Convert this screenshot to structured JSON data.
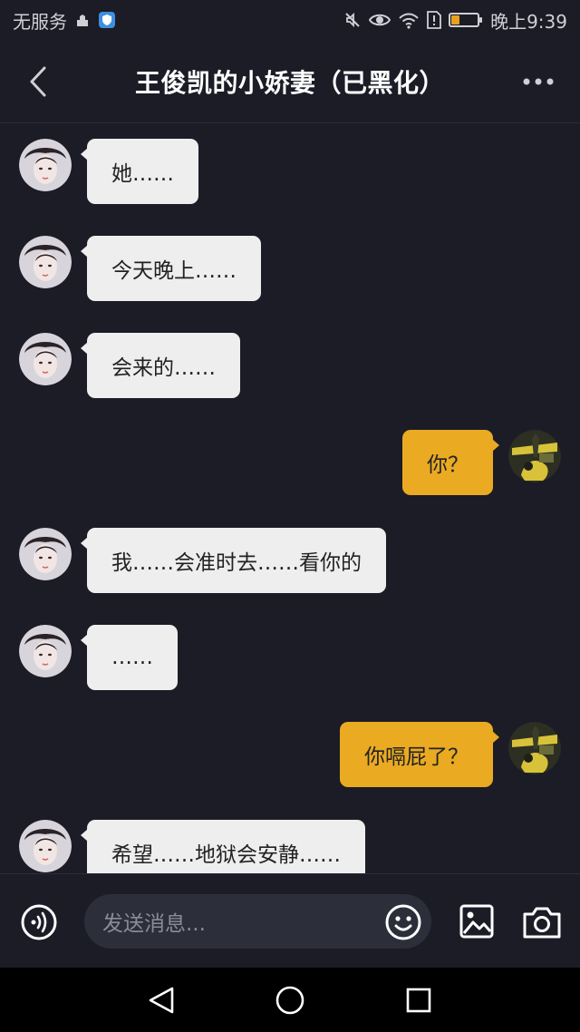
{
  "status_bar": {
    "carrier": "无服务",
    "time": "晚上9:39"
  },
  "header": {
    "title": "王俊凯的小娇妻（已黑化）"
  },
  "messages": [
    {
      "side": "left",
      "text": "她……",
      "avatar": "boy-avatar"
    },
    {
      "side": "left",
      "text": "今天晚上……",
      "avatar": "boy-avatar"
    },
    {
      "side": "left",
      "text": "会来的……",
      "avatar": "boy-avatar"
    },
    {
      "side": "right",
      "text": "你？",
      "avatar": "anime-avatar"
    },
    {
      "side": "left",
      "text": "我……会准时去……看你的",
      "avatar": "boy-avatar"
    },
    {
      "side": "left",
      "text": "……",
      "avatar": "boy-avatar"
    },
    {
      "side": "right",
      "text": "你嗝屁了？",
      "avatar": "anime-avatar"
    },
    {
      "side": "left",
      "text": "希望……地狱会安静……",
      "avatar": "boy-avatar"
    }
  ],
  "input": {
    "placeholder": "发送消息..."
  },
  "colors": {
    "background": "#1b1c26",
    "bubble_incoming": "#eeeeee",
    "bubble_outgoing": "#eaaa22",
    "input_field": "#2c2e3a"
  }
}
